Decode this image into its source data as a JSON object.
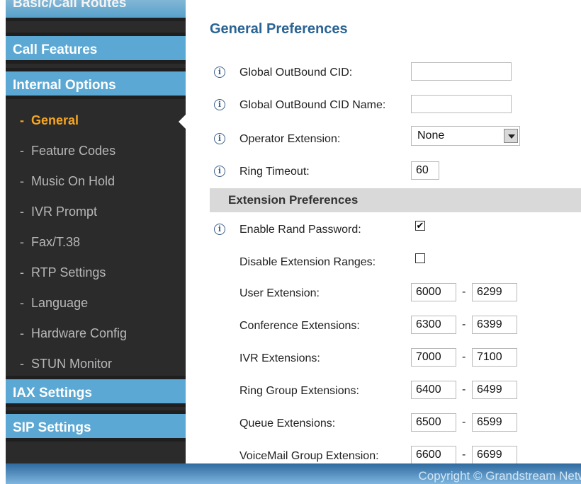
{
  "sidebar": {
    "top_partial": "Basic/Call Routes",
    "headers": [
      "Call Features",
      "Internal Options",
      "IAX Settings",
      "SIP Settings"
    ],
    "items": [
      {
        "label": "General",
        "active": true
      },
      {
        "label": "Feature Codes",
        "active": false
      },
      {
        "label": "Music On Hold",
        "active": false
      },
      {
        "label": "IVR Prompt",
        "active": false
      },
      {
        "label": "Fax/T.38",
        "active": false
      },
      {
        "label": "RTP Settings",
        "active": false
      },
      {
        "label": "Language",
        "active": false
      },
      {
        "label": "Hardware Config",
        "active": false
      },
      {
        "label": "STUN Monitor",
        "active": false
      }
    ],
    "dash": "-"
  },
  "main": {
    "title": "General Preferences",
    "info_glyph": "i",
    "fields": {
      "global_outbound_cid": {
        "label": "Global OutBound CID:",
        "value": ""
      },
      "global_outbound_cid_name": {
        "label": "Global OutBound CID Name:",
        "value": ""
      },
      "operator_extension": {
        "label": "Operator Extension:",
        "value": "None"
      },
      "ring_timeout": {
        "label": "Ring Timeout:",
        "value": "60"
      }
    },
    "section_title": "Extension Preferences",
    "enable_rand_password": {
      "label": "Enable Rand Password:",
      "checked": true,
      "mark": "✔"
    },
    "disable_extension_ranges": {
      "label": "Disable Extension Ranges:",
      "checked": false,
      "mark": ""
    },
    "range_separator": "-",
    "ranges": [
      {
        "label": "User Extension:",
        "from": "6000",
        "to": "6299"
      },
      {
        "label": "Conference Extensions:",
        "from": "6300",
        "to": "6399"
      },
      {
        "label": "IVR Extensions:",
        "from": "7000",
        "to": "7100"
      },
      {
        "label": "Ring Group Extensions:",
        "from": "6400",
        "to": "6499"
      },
      {
        "label": "Queue Extensions:",
        "from": "6500",
        "to": "6599"
      },
      {
        "label": "VoiceMail Group Extension:",
        "from": "6600",
        "to": "6699"
      }
    ]
  },
  "footer": {
    "copyright": "Copyright © Grandstream Networks"
  },
  "colors": {
    "accent": "#5ba8d4",
    "active": "#f5a623",
    "title": "#2a6494"
  }
}
